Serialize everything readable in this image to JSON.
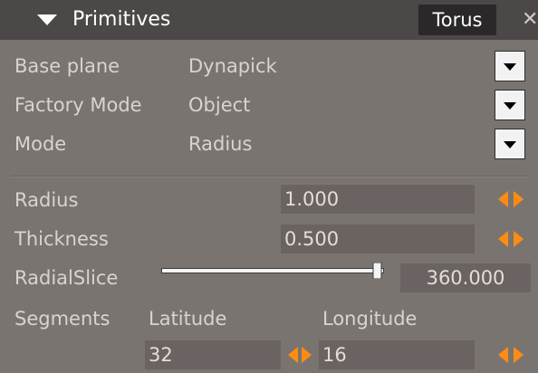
{
  "panel": {
    "title": "Primitives",
    "primitive_type": "Torus",
    "close_glyph": "✕",
    "icons": {
      "collapse": "triangle-down",
      "dropdown": "triangle-down",
      "spin": "left-right-arrows"
    },
    "colors": {
      "titlebar": "#4b4847",
      "panel_bg": "#7a7470",
      "field_bg": "#6a6361",
      "spin_arrow": "#ff8c10",
      "text": "#d9d4cf"
    }
  },
  "options": [
    {
      "label": "Base plane",
      "value": "Dynapick"
    },
    {
      "label": "Factory Mode",
      "value": "Object"
    },
    {
      "label": "Mode",
      "value": "Radius"
    }
  ],
  "params": {
    "radius": {
      "label": "Radius",
      "value": "1.000"
    },
    "thickness": {
      "label": "Thickness",
      "value": "0.500"
    },
    "radial_slice": {
      "label": "RadialSlice",
      "value": "360.000",
      "fraction": 1.0
    }
  },
  "segments": {
    "label": "Segments",
    "latitude_label": "Latitude",
    "latitude_value": "32",
    "longitude_label": "Longitude",
    "longitude_value": "16"
  }
}
